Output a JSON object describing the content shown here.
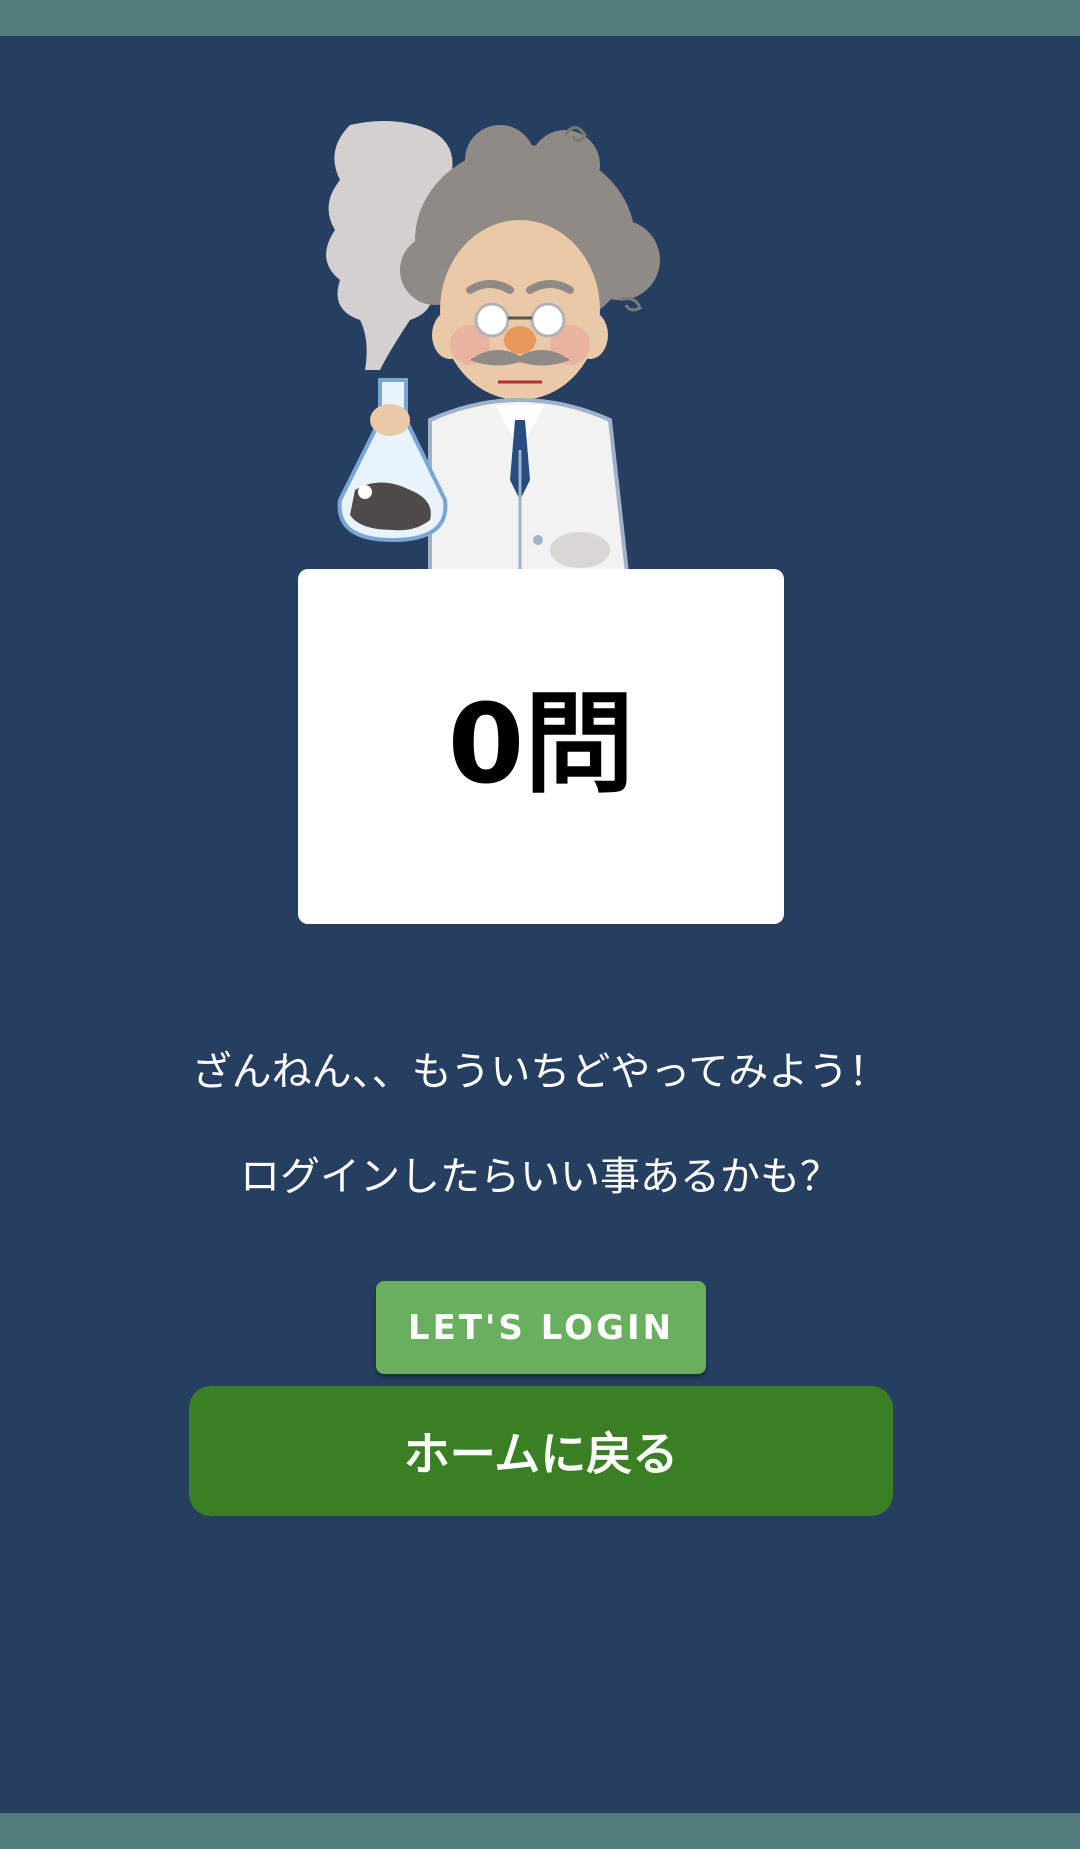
{
  "result": {
    "score": "0問",
    "message_line1": "ざんねん、、もういちどやってみよう！",
    "message_line2": "ログインしたらいい事あるかも？"
  },
  "buttons": {
    "login_label": "LET'S LOGIN",
    "home_label": "ホームに戻る"
  },
  "illustration": {
    "name": "scientist-with-smoking-flask"
  },
  "colors": {
    "background": "#263f60",
    "bar": "#527b7c",
    "login_button": "#6aae5f",
    "home_button": "#3a7f23",
    "card": "#ffffff"
  }
}
